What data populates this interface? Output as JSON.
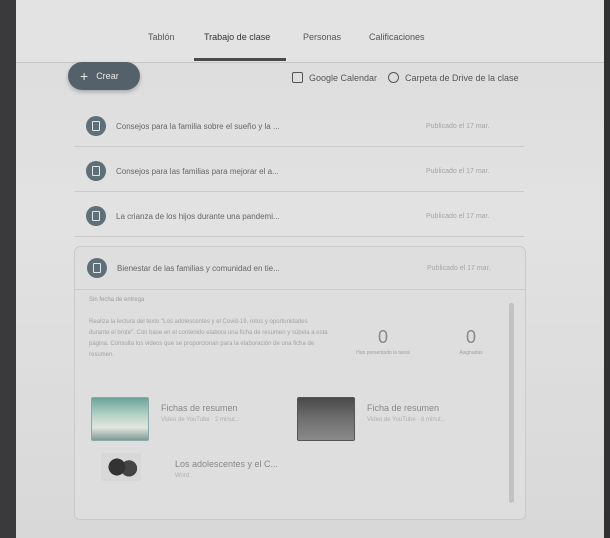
{
  "nav": {
    "tabs": [
      "Tablón",
      "Trabajo de clase",
      "Personas",
      "Calificaciones"
    ]
  },
  "toolbar": {
    "create_label": "Crear",
    "calendar_label": "Google Calendar",
    "drive_label": "Carpeta de Drive de la clase"
  },
  "posts": [
    {
      "title": "Consejos para la familia sobre el sueño y la ...",
      "date": "Publicado el 17 mar."
    },
    {
      "title": "Consejos para las familias para mejorar el a...",
      "date": "Publicado el 17 mar."
    },
    {
      "title": "La crianza de los hijos durante una pandemi...",
      "date": "Publicado el 17 mar."
    },
    {
      "title": "Bienestar de las familias y comunidad en tie...",
      "date": "Publicado el 17 mar."
    }
  ],
  "expanded": {
    "due": "Sin fecha de entrega",
    "description": "Realiza la lectura del texto \"Los adolescentes y el Covid-19, retos y oportunidades durante el brote\". Con base en el contenido elabora una ficha de resumen y súbela a esta página. Consulta los videos que se proporcionan para la elaboración de una ficha de resumen.",
    "stats": [
      {
        "num": "0",
        "label": "Han presentado la tarea"
      },
      {
        "num": "0",
        "label": "Asignadas"
      }
    ],
    "attachments": [
      {
        "title": "Fichas de resumen",
        "subtitle": "Video de YouTube · 2 minut..."
      },
      {
        "title": "Ficha de resumen",
        "subtitle": "Video de YouTube · 8 minut..."
      },
      {
        "title": "Los adolescentes y el C...",
        "subtitle": "Word"
      }
    ]
  }
}
